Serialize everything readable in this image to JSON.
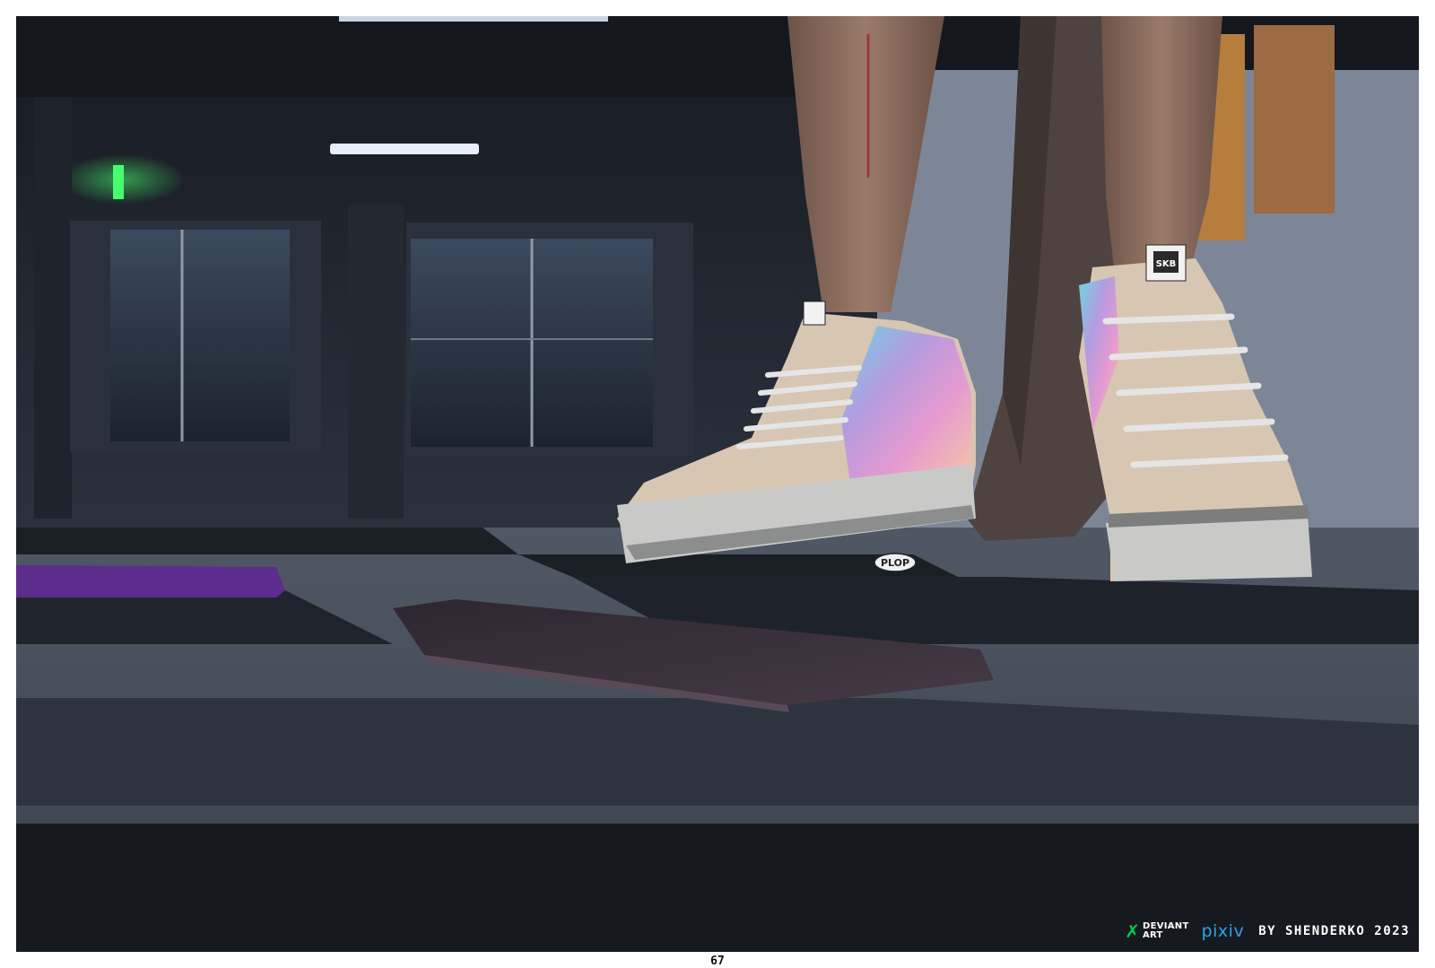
{
  "credits": {
    "deviantart_line1": "DEVIANT",
    "deviantart_line2": "ART",
    "pixiv": "pixiv",
    "byline": "BY SHENDERKO 2023"
  },
  "sfx": "PLOP",
  "shoe_tag": "SKB",
  "page_number": "67",
  "colors": {
    "frame": "#ffffff",
    "deviantart": "#05cc47",
    "pixiv": "#2ba3ee",
    "exit_sign": "#47ff6c"
  }
}
